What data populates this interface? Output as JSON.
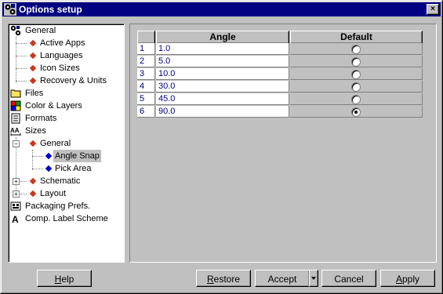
{
  "window": {
    "title": "Options setup",
    "close_glyph": "×"
  },
  "tree": {
    "items": [
      {
        "label": "General",
        "icon": "gears-icon"
      },
      {
        "label": "Active Apps",
        "icon": "red-diamond-icon"
      },
      {
        "label": "Languages",
        "icon": "red-diamond-icon"
      },
      {
        "label": "Icon Sizes",
        "icon": "red-diamond-icon"
      },
      {
        "label": "Recovery & Units",
        "icon": "red-diamond-icon"
      },
      {
        "label": "Files",
        "icon": "folder-icon"
      },
      {
        "label": "Color & Layers",
        "icon": "palette-icon"
      },
      {
        "label": "Formats",
        "icon": "document-icon"
      },
      {
        "label": "Sizes",
        "icon": "ruler-icon"
      },
      {
        "label": "General",
        "icon": "red-diamond-icon",
        "expander": "−"
      },
      {
        "label": "Angle Snap",
        "icon": "blue-diamond-icon",
        "selected": true
      },
      {
        "label": "Pick Area",
        "icon": "blue-diamond-icon"
      },
      {
        "label": "Schematic",
        "icon": "red-diamond-icon",
        "expander": "+"
      },
      {
        "label": "Layout",
        "icon": "red-diamond-icon",
        "expander": "+"
      },
      {
        "label": "Packaging Prefs.",
        "icon": "package-icon"
      },
      {
        "label": "Comp. Label Scheme",
        "icon": "letter-a-icon"
      }
    ]
  },
  "grid": {
    "headers": {
      "num": "",
      "angle": "Angle",
      "default": "Default"
    },
    "rows": [
      {
        "num": "1",
        "angle": "1.0",
        "default": false
      },
      {
        "num": "2",
        "angle": "5.0",
        "default": false
      },
      {
        "num": "3",
        "angle": "10.0",
        "default": false
      },
      {
        "num": "4",
        "angle": "30.0",
        "default": false
      },
      {
        "num": "5",
        "angle": "45.0",
        "default": false
      },
      {
        "num": "6",
        "angle": "90.0",
        "default": true
      }
    ]
  },
  "buttons": {
    "help": {
      "label_underline": "H",
      "label_rest": "elp"
    },
    "restore": {
      "label_underline": "R",
      "label_rest": "estore"
    },
    "accept": {
      "label": "Accept"
    },
    "cancel": {
      "label": "Cancel"
    },
    "apply": {
      "label_underline": "A",
      "label_rest": "pply"
    }
  },
  "colors": {
    "titlebar": "#000080",
    "tree_red": "#c8391c",
    "tree_blue": "#0000c8",
    "cell_text": "#000080"
  }
}
